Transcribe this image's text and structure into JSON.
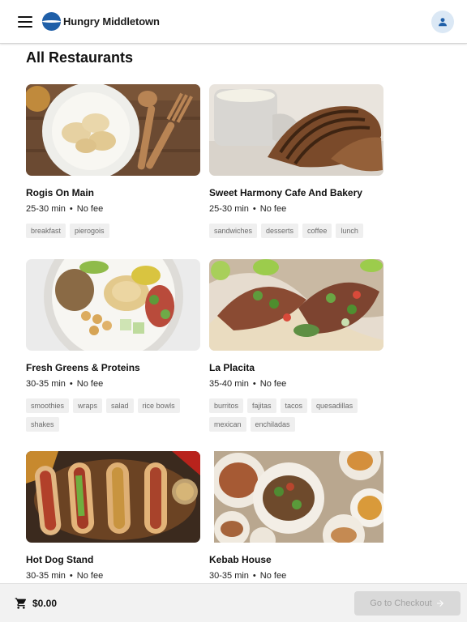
{
  "header": {
    "app_title": "Hungry Middletown",
    "menu_icon": "menu-icon",
    "logo_icon": "logo-icon",
    "account_icon": "person-icon",
    "brand_color": "#1f5fa8"
  },
  "main": {
    "section_title": "All Restaurants",
    "restaurants": [
      {
        "name": "Rogis On Main",
        "time": "25-30 min",
        "fee": "No fee",
        "tags": [
          "breakfast",
          "pierogois"
        ]
      },
      {
        "name": "Sweet Harmony Cafe And Bakery",
        "time": "25-30 min",
        "fee": "No fee",
        "tags": [
          "sandwiches",
          "desserts",
          "coffee",
          "lunch"
        ]
      },
      {
        "name": "Fresh Greens & Proteins",
        "time": "30-35 min",
        "fee": "No fee",
        "tags": [
          "smoothies",
          "wraps",
          "salad",
          "rice bowls",
          "shakes"
        ]
      },
      {
        "name": "La Placita",
        "time": "35-40 min",
        "fee": "No fee",
        "tags": [
          "burritos",
          "fajitas",
          "tacos",
          "quesadillas",
          "mexican",
          "enchiladas"
        ]
      },
      {
        "name": "Hot Dog Stand",
        "time": "30-35 min",
        "fee": "No fee",
        "tags": []
      },
      {
        "name": "Kebab House",
        "time": "30-35 min",
        "fee": "No fee",
        "tags": []
      }
    ]
  },
  "footer": {
    "cart_icon": "cart-icon",
    "cart_total": "$0.00",
    "checkout_label": "Go to Checkout",
    "checkout_icon": "arrow-right-icon"
  }
}
